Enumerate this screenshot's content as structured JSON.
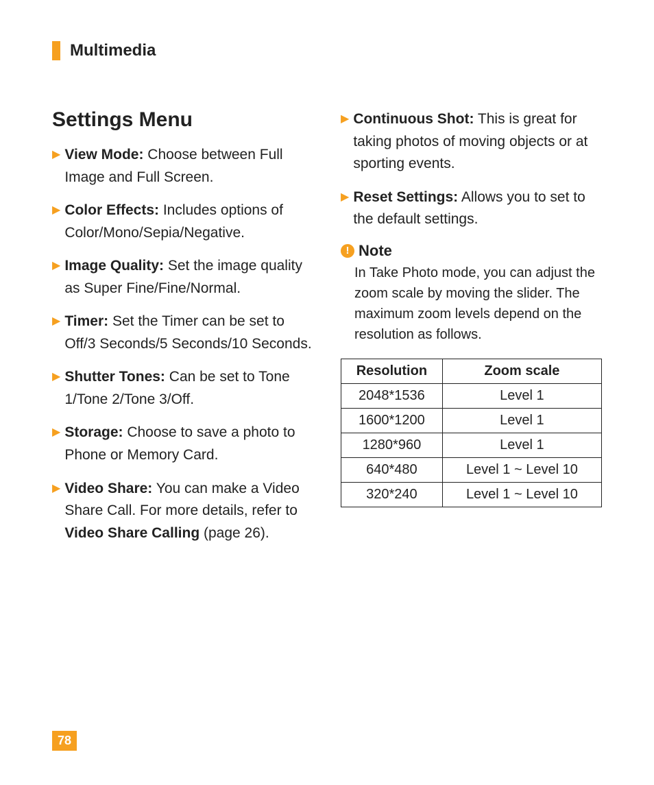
{
  "section": "Multimedia",
  "heading": "Settings Menu",
  "left_items": [
    {
      "label": "View Mode:",
      "text": " Choose between Full Image and Full Screen."
    },
    {
      "label": "Color Effects:",
      "text": " Includes options of Color/Mono/Sepia/Negative."
    },
    {
      "label": "Image Quality:",
      "text": " Set the image quality as Super Fine/Fine/Normal."
    },
    {
      "label": "Timer:",
      "text": " Set the Timer can be set to Off/3 Seconds/5 Seconds/10 Seconds."
    },
    {
      "label": "Shutter Tones:",
      "text": " Can be set to Tone 1/Tone 2/Tone 3/Off."
    },
    {
      "label": "Storage:",
      "text": " Choose to save a photo to Phone or Memory Card."
    },
    {
      "label": "Video Share:",
      "text": " You can make a Video Share Call. For more details, refer to ",
      "bold_tail": "Video Share Calling",
      "tail": " (page 26)."
    }
  ],
  "right_items": [
    {
      "label": "Continuous Shot:",
      "text": " This is great for taking photos of moving objects or at sporting events."
    },
    {
      "label": "Reset Settings:",
      "text": " Allows you to set to the default settings."
    }
  ],
  "note": {
    "title": "Note",
    "body": "In Take Photo mode, you can adjust the zoom scale by moving the slider. The maximum zoom levels depend on the resolution as follows."
  },
  "table": {
    "headers": [
      "Resolution",
      "Zoom scale"
    ],
    "rows": [
      [
        "2048*1536",
        "Level 1"
      ],
      [
        "1600*1200",
        "Level 1"
      ],
      [
        "1280*960",
        "Level 1"
      ],
      [
        "640*480",
        "Level 1 ~ Level 10"
      ],
      [
        "320*240",
        "Level 1 ~ Level 10"
      ]
    ]
  },
  "page_number": "78",
  "chart_data": {
    "type": "table",
    "title": "Maximum zoom scale by resolution",
    "columns": [
      "Resolution",
      "Zoom scale"
    ],
    "rows": [
      [
        "2048*1536",
        "Level 1"
      ],
      [
        "1600*1200",
        "Level 1"
      ],
      [
        "1280*960",
        "Level 1"
      ],
      [
        "640*480",
        "Level 1 ~ Level 10"
      ],
      [
        "320*240",
        "Level 1 ~ Level 10"
      ]
    ]
  }
}
